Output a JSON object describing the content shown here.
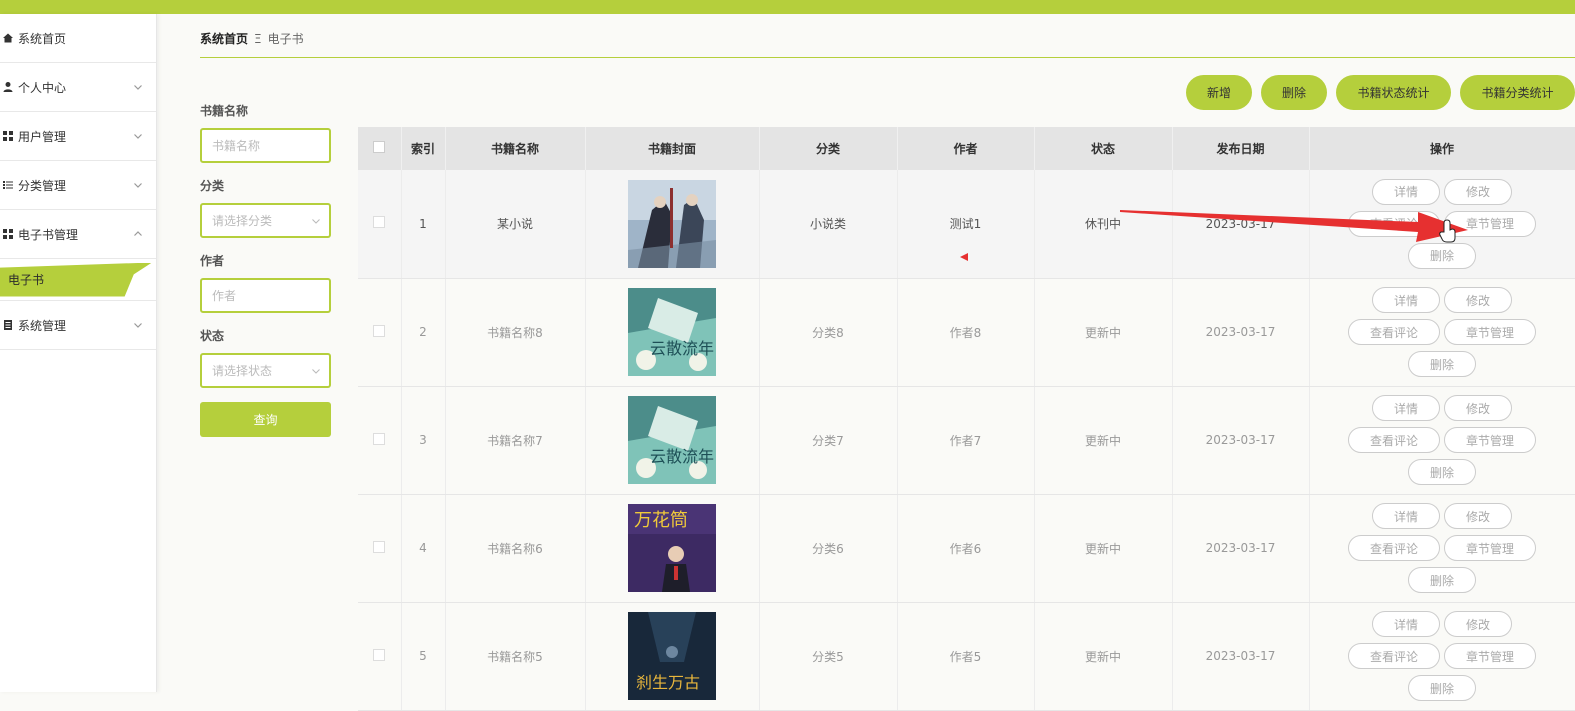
{
  "colors": {
    "accent": "#b5cf3c",
    "arrow": "#e63030"
  },
  "sidebar": {
    "items": [
      {
        "label": "系统首页",
        "icon": "home-icon"
      },
      {
        "label": "个人中心",
        "icon": "user-icon"
      },
      {
        "label": "用户管理",
        "icon": "grid-icon"
      },
      {
        "label": "分类管理",
        "icon": "list-icon"
      },
      {
        "label": "电子书管理",
        "icon": "grid-icon"
      },
      {
        "label": "系统管理",
        "icon": "doc-icon"
      }
    ],
    "sub_item": "电子书"
  },
  "breadcrumb": {
    "home": "系统首页",
    "separator": "Ξ",
    "current": "电子书"
  },
  "filters": {
    "name_label": "书籍名称",
    "name_placeholder": "书籍名称",
    "category_label": "分类",
    "category_placeholder": "请选择分类",
    "author_label": "作者",
    "author_placeholder": "作者",
    "status_label": "状态",
    "status_placeholder": "请选择状态",
    "query_button": "查询"
  },
  "actions": {
    "add": "新增",
    "delete": "删除",
    "status_stats": "书籍状态统计",
    "category_stats": "书籍分类统计"
  },
  "table": {
    "headers": {
      "index": "索引",
      "name": "书籍名称",
      "cover": "书籍封面",
      "category": "分类",
      "author": "作者",
      "status": "状态",
      "date": "发布日期",
      "ops": "操作"
    },
    "rows": [
      {
        "index": "1",
        "name": "某小说",
        "category": "小说类",
        "author": "测试1",
        "status": "休刊中",
        "date": "2023-03-17"
      },
      {
        "index": "2",
        "name": "书籍名称8",
        "category": "分类8",
        "author": "作者8",
        "status": "更新中",
        "date": "2023-03-17"
      },
      {
        "index": "3",
        "name": "书籍名称7",
        "category": "分类7",
        "author": "作者7",
        "status": "更新中",
        "date": "2023-03-17"
      },
      {
        "index": "4",
        "name": "书籍名称6",
        "category": "分类6",
        "author": "作者6",
        "status": "更新中",
        "date": "2023-03-17"
      },
      {
        "index": "5",
        "name": "书籍名称5",
        "category": "分类5",
        "author": "作者5",
        "status": "更新中",
        "date": "2023-03-17"
      }
    ],
    "ops": {
      "detail": "详情",
      "edit": "修改",
      "comments": "查看评论",
      "chapters": "章节管理",
      "delete": "删除"
    }
  },
  "cover_texts": {
    "r2": "云散流年",
    "r3": "云散流年",
    "r4": "万花筒",
    "r5": "刹生万古"
  }
}
